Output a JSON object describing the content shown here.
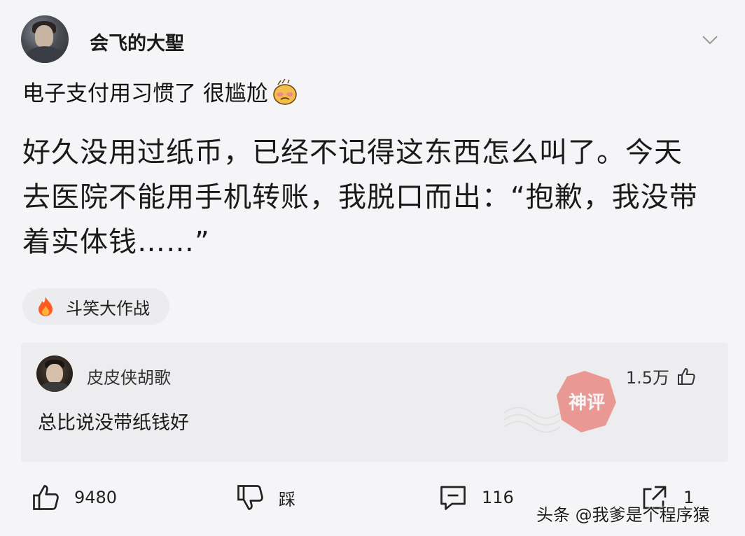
{
  "post": {
    "author": "会飞的大聖",
    "subtitle": "电子支付用习惯了 很尴尬",
    "body": "好久没用过纸币，已经不记得这东西怎么叫了。今天去医院不能用手机转账，我脱口而出：“抱歉，我没带着实体钱……”",
    "topic": "斗笑大作战"
  },
  "comment": {
    "author": "皮皮侠胡歌",
    "likes": "1.5万",
    "text": "总比说没带纸钱好",
    "stamp_text": "神评"
  },
  "footer": {
    "likes": "9480",
    "dislike_label": "踩",
    "comments": "116",
    "shares": "1"
  },
  "watermark": "头条 @我爹是个程序猿",
  "icons": {
    "author_avatar": "avatar",
    "expand": "chevron-down-icon",
    "subtitle_emoji": "embarrassed-emoji-icon",
    "topic": "flame-icon",
    "comment_like": "thumbs-up-icon",
    "like": "thumbs-up-icon",
    "dislike": "thumbs-down-icon",
    "comment": "comment-icon",
    "share": "share-icon"
  },
  "colors": {
    "background": "#f5f5f7",
    "comment_bg": "#ededef",
    "topic_bg": "#ececee",
    "flame": "#ff5a1f",
    "stamp": "#e8534a"
  }
}
